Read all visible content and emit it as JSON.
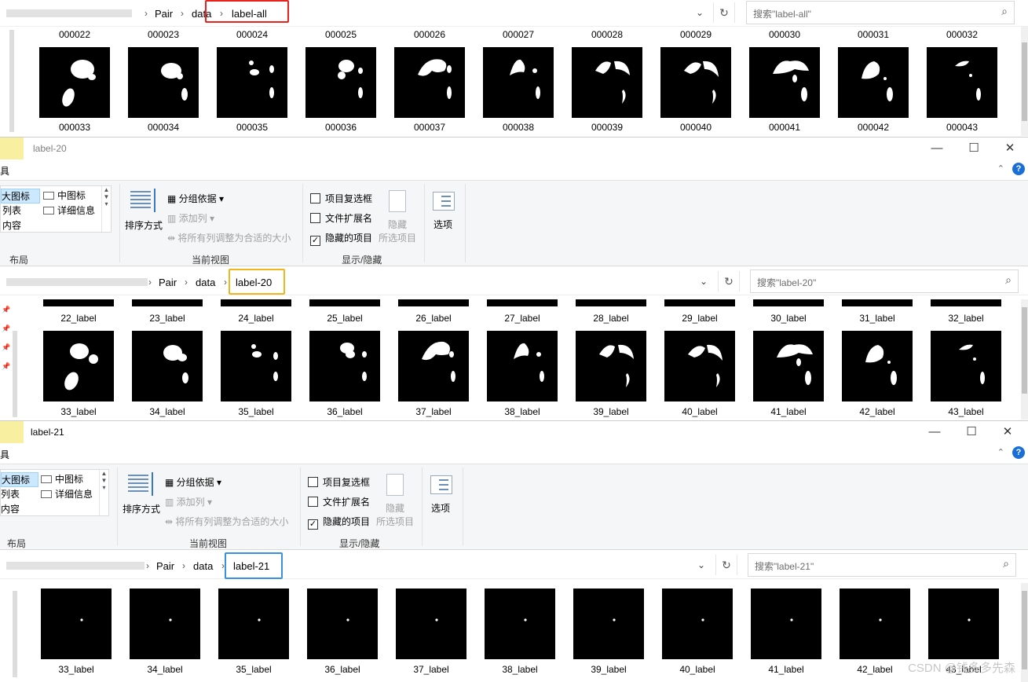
{
  "win_all": {
    "crumbs": [
      "Pair",
      "data",
      "label-all"
    ],
    "search_placeholder": "搜索\"label-all\"",
    "row1": [
      "000022",
      "000023",
      "000024",
      "000025",
      "000026",
      "000027",
      "000028",
      "000029",
      "000030",
      "000031",
      "000032"
    ],
    "row2": [
      "000033",
      "000034",
      "000035",
      "000036",
      "000037",
      "000038",
      "000039",
      "000040",
      "000041",
      "000042",
      "000043"
    ]
  },
  "win20": {
    "title": "label-20",
    "tab_fragment": "具",
    "crumbs": [
      "Pair",
      "data",
      "label-20"
    ],
    "search_placeholder": "搜索\"label-20\"",
    "row1": [
      "22_label",
      "23_label",
      "24_label",
      "25_label",
      "26_label",
      "27_label",
      "28_label",
      "29_label",
      "30_label",
      "31_label",
      "32_label"
    ],
    "row2": [
      "33_label",
      "34_label",
      "35_label",
      "36_label",
      "37_label",
      "38_label",
      "39_label",
      "40_label",
      "41_label",
      "42_label",
      "43_label"
    ]
  },
  "win21": {
    "title": "label-21",
    "tab_fragment": "具",
    "crumbs": [
      "Pair",
      "data",
      "label-21"
    ],
    "search_placeholder": "搜索\"label-21\"",
    "row1": [
      "33_label",
      "34_label",
      "35_label",
      "36_label",
      "37_label",
      "38_label",
      "39_label",
      "40_label",
      "41_label",
      "42_label",
      "43_label"
    ]
  },
  "ribbon": {
    "layout_large": "大图标",
    "layout_medium": "中图标",
    "layout_list": "列表",
    "layout_details": "详细信息",
    "layout_content": "内容",
    "layout_group": "布局",
    "sort_by": "排序方式",
    "group_by": "分组依据",
    "add_column": "添加列",
    "fit_columns": "将所有列调整为合适的大小",
    "current_view_group": "当前视图",
    "item_checkboxes": "项目复选框",
    "file_extensions": "文件扩展名",
    "hidden_items": "隐藏的项目",
    "hide_selected_1": "隐藏",
    "hide_selected_2": "所选项目",
    "showhide_group": "显示/隐藏",
    "options": "选项"
  },
  "watermark": "CSDN @钱多多先森",
  "colors": {
    "red_box": "#e8231d",
    "yellow_box": "#f2b51d",
    "blue_box": "#3a8fe0",
    "ribbon_bg": "#f5f6f7"
  }
}
